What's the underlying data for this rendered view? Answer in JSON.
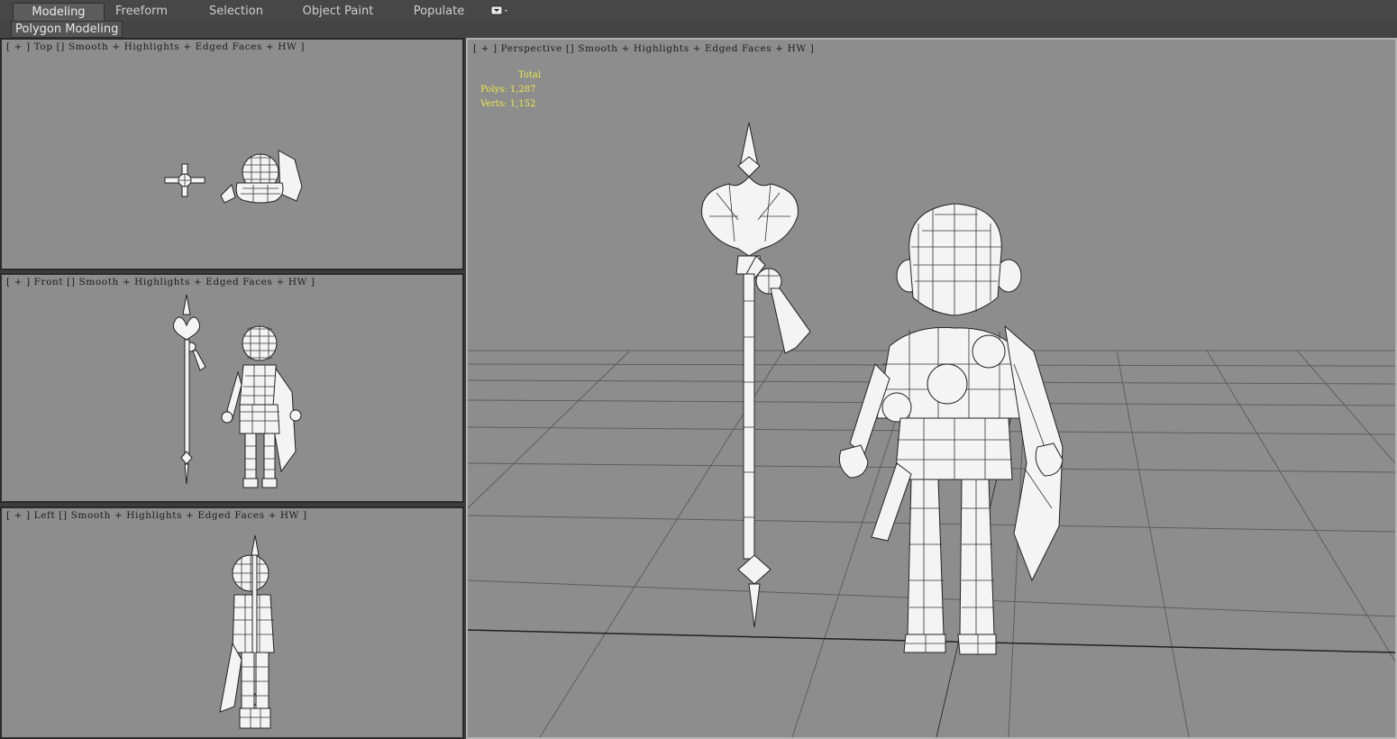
{
  "ribbon": {
    "tabs": [
      {
        "label": "Modeling",
        "active": true
      },
      {
        "label": "Freeform",
        "active": false
      },
      {
        "label": "Selection",
        "active": false
      },
      {
        "label": "Object Paint",
        "active": false
      },
      {
        "label": "Populate",
        "active": false
      }
    ],
    "dropdown_icon": "dropdown-caret-icon",
    "sub_label": "Polygon Modeling"
  },
  "viewports": {
    "top": {
      "name": "Top",
      "shading": "Smooth + Highlights + Edged Faces + HW"
    },
    "front": {
      "name": "Front",
      "shading": "Smooth + Highlights + Edged Faces + HW"
    },
    "left": {
      "name": "Left",
      "shading": "Smooth + Highlights + Edged Faces + HW"
    },
    "perspective": {
      "name": "Perspective",
      "shading": "Smooth + Highlights + Edged Faces + HW"
    }
  },
  "label_parts": {
    "open": "[ + ]",
    "close": "]"
  },
  "stats": {
    "header": "Total",
    "polys_label": "Polys:",
    "polys_value": "1,287",
    "verts_label": "Verts:",
    "verts_value": "1,152"
  },
  "colors": {
    "viewport_bg": "#8d8d8d",
    "stats_text": "#e8e84a",
    "active_border": "#b3b3b3"
  }
}
